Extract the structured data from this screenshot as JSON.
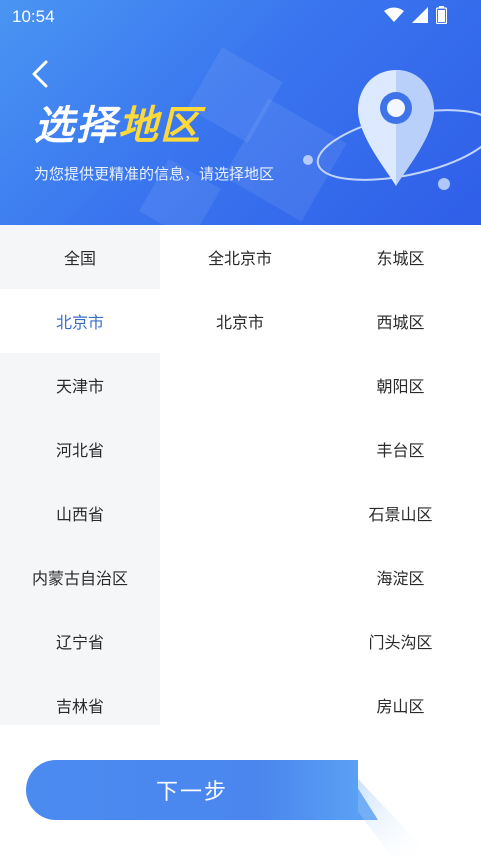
{
  "status_bar": {
    "time": "10:54"
  },
  "header": {
    "title_part1": "选择",
    "title_part2": "地区",
    "subtitle": "为您提供更精准的信息，请选择地区"
  },
  "provinces": [
    "全国",
    "北京市",
    "天津市",
    "河北省",
    "山西省",
    "内蒙古自治区",
    "辽宁省",
    "吉林省"
  ],
  "selected_province": "北京市",
  "cities": [
    "全北京市",
    "北京市"
  ],
  "districts": [
    "东城区",
    "西城区",
    "朝阳区",
    "丰台区",
    "石景山区",
    "海淀区",
    "门头沟区",
    "房山区"
  ],
  "next_button": {
    "label": "下一步"
  },
  "colors": {
    "accent": "#3b6ec9",
    "header_blue": "#3a76ef",
    "title_yellow": "#ffd83a"
  },
  "icons": [
    "wifi-icon",
    "signal-icon",
    "battery-icon",
    "back-arrow-icon",
    "location-pin-icon"
  ]
}
